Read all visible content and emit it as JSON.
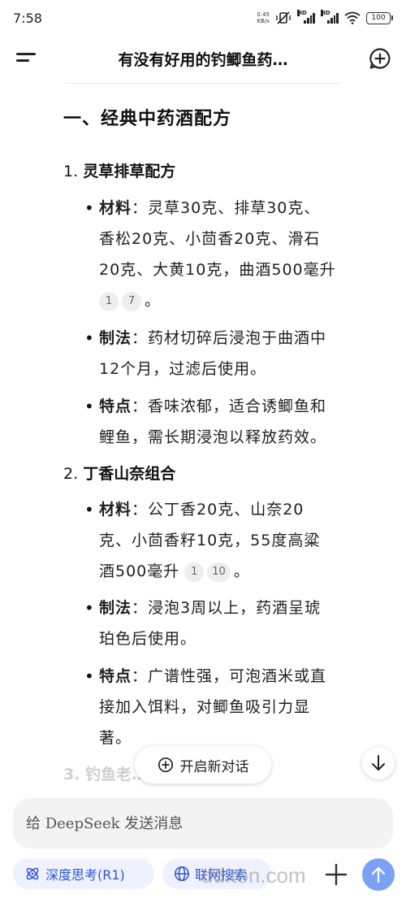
{
  "status": {
    "time": "7:58",
    "net_speed_value": "0.45",
    "net_speed_unit": "KB/s",
    "hd1": "HD",
    "hd2": "HD",
    "battery": "100"
  },
  "header": {
    "title": "有没有好用的钓鲫鱼药…"
  },
  "content": {
    "section_title": "一、经典中药酒配方",
    "items": [
      {
        "number": "1.",
        "heading": "灵草排草配方",
        "bullets": [
          {
            "label": "材料",
            "lines": [
              "：灵草30克、排草30克、",
              "香松20克、小茴香20克、滑石",
              "20克、大黄10克，曲酒500毫升"
            ],
            "citations": [
              "1",
              "7"
            ],
            "tail": "。"
          },
          {
            "label": "制法",
            "lines": [
              "：药材切碎后浸泡于曲酒中",
              "12个月，过滤后使用。"
            ]
          },
          {
            "label": "特点",
            "lines": [
              "：香味浓郁，适合诱鲫鱼和",
              "鲤鱼，需长期浸泡以释放药效。"
            ]
          }
        ]
      },
      {
        "number": "2.",
        "heading": "丁香山奈组合",
        "bullets": [
          {
            "label": "材料",
            "lines": [
              "：公丁香20克、山奈20",
              "克、小茴香籽10克，55度高粱",
              "酒500毫升"
            ],
            "citations": [
              "1",
              "10"
            ],
            "tail": "。"
          },
          {
            "label": "制法",
            "lines": [
              "：浸泡3周以上，药酒呈琥",
              "珀色后使用。"
            ]
          },
          {
            "label": "特点",
            "lines": [
              "：广谱性强，可泡酒米或直",
              "接加入饵料，对鲫鱼吸引力显",
              "著。"
            ]
          }
        ]
      }
    ],
    "faded_text": "3. 钓鱼老……方”"
  },
  "new_chat_label": "开启新对话",
  "input": {
    "placeholder": "给 DeepSeek 发送消息"
  },
  "chips": {
    "deep_think": "深度思考(R1)",
    "web_search": "联网搜索"
  },
  "watermark": "dd.ton.com",
  "colors": {
    "accent": "#2f55d4",
    "chip_bg": "#eef2ff",
    "send_bg": "#7aa1f5"
  },
  "icons": {
    "menu": "menu-icon",
    "new_chat": "add-chat-icon",
    "scroll_down": "arrow-down-icon",
    "deep_think": "atom-icon",
    "web_search": "globe-icon",
    "plus": "plus-icon",
    "send": "arrow-up-icon"
  }
}
